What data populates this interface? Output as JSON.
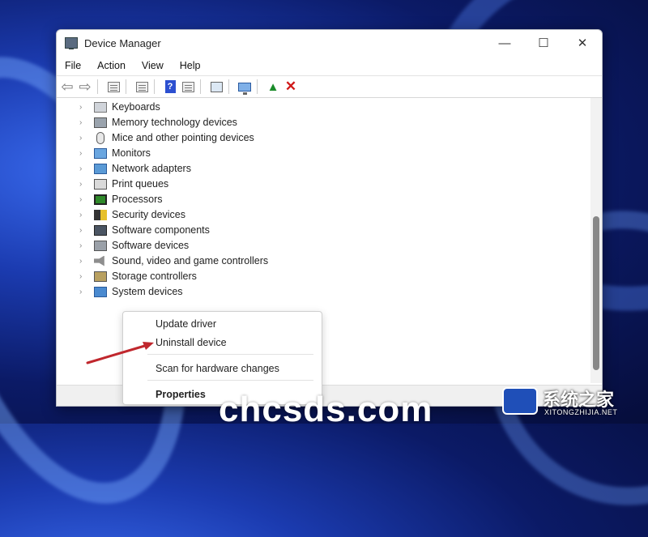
{
  "window": {
    "title": "Device Manager",
    "controls": {
      "minimize": "—",
      "maximize": "☐",
      "close": "✕"
    }
  },
  "menu": [
    "File",
    "Action",
    "View",
    "Help"
  ],
  "toolbar": {
    "icons": [
      "back-arrow",
      "forward-arrow",
      "properties",
      "show-hidden",
      "help",
      "update-view",
      "scan-hardware",
      "monitor",
      "enable-device",
      "uninstall-device"
    ]
  },
  "tree": {
    "items": [
      {
        "label": "Keyboards",
        "icon": "keyboard"
      },
      {
        "label": "Memory technology devices",
        "icon": "memory-card"
      },
      {
        "label": "Mice and other pointing devices",
        "icon": "mouse"
      },
      {
        "label": "Monitors",
        "icon": "monitor"
      },
      {
        "label": "Network adapters",
        "icon": "network-adapter"
      },
      {
        "label": "Print queues",
        "icon": "printer"
      },
      {
        "label": "Processors",
        "icon": "processor"
      },
      {
        "label": "Security devices",
        "icon": "security-key"
      },
      {
        "label": "Software components",
        "icon": "software-component"
      },
      {
        "label": "Software devices",
        "icon": "software-device"
      },
      {
        "label": "Sound, video and game controllers",
        "icon": "speaker"
      },
      {
        "label": "Storage controllers",
        "icon": "storage"
      },
      {
        "label": "System devices",
        "icon": "system"
      }
    ]
  },
  "context_menu": {
    "items": [
      "Update driver",
      "Uninstall device",
      "Scan for hardware changes",
      "Properties"
    ],
    "highlight": "Uninstall device"
  },
  "watermark": {
    "domain": "chcsds.com",
    "logo_cn": "系统之家",
    "logo_en": "XITONGZHIJIA.NET"
  },
  "colors": {
    "accent_red_arrow": "#c0272d",
    "uninstall_x": "#d01818",
    "desktop_blue": "#1b3bb0"
  }
}
